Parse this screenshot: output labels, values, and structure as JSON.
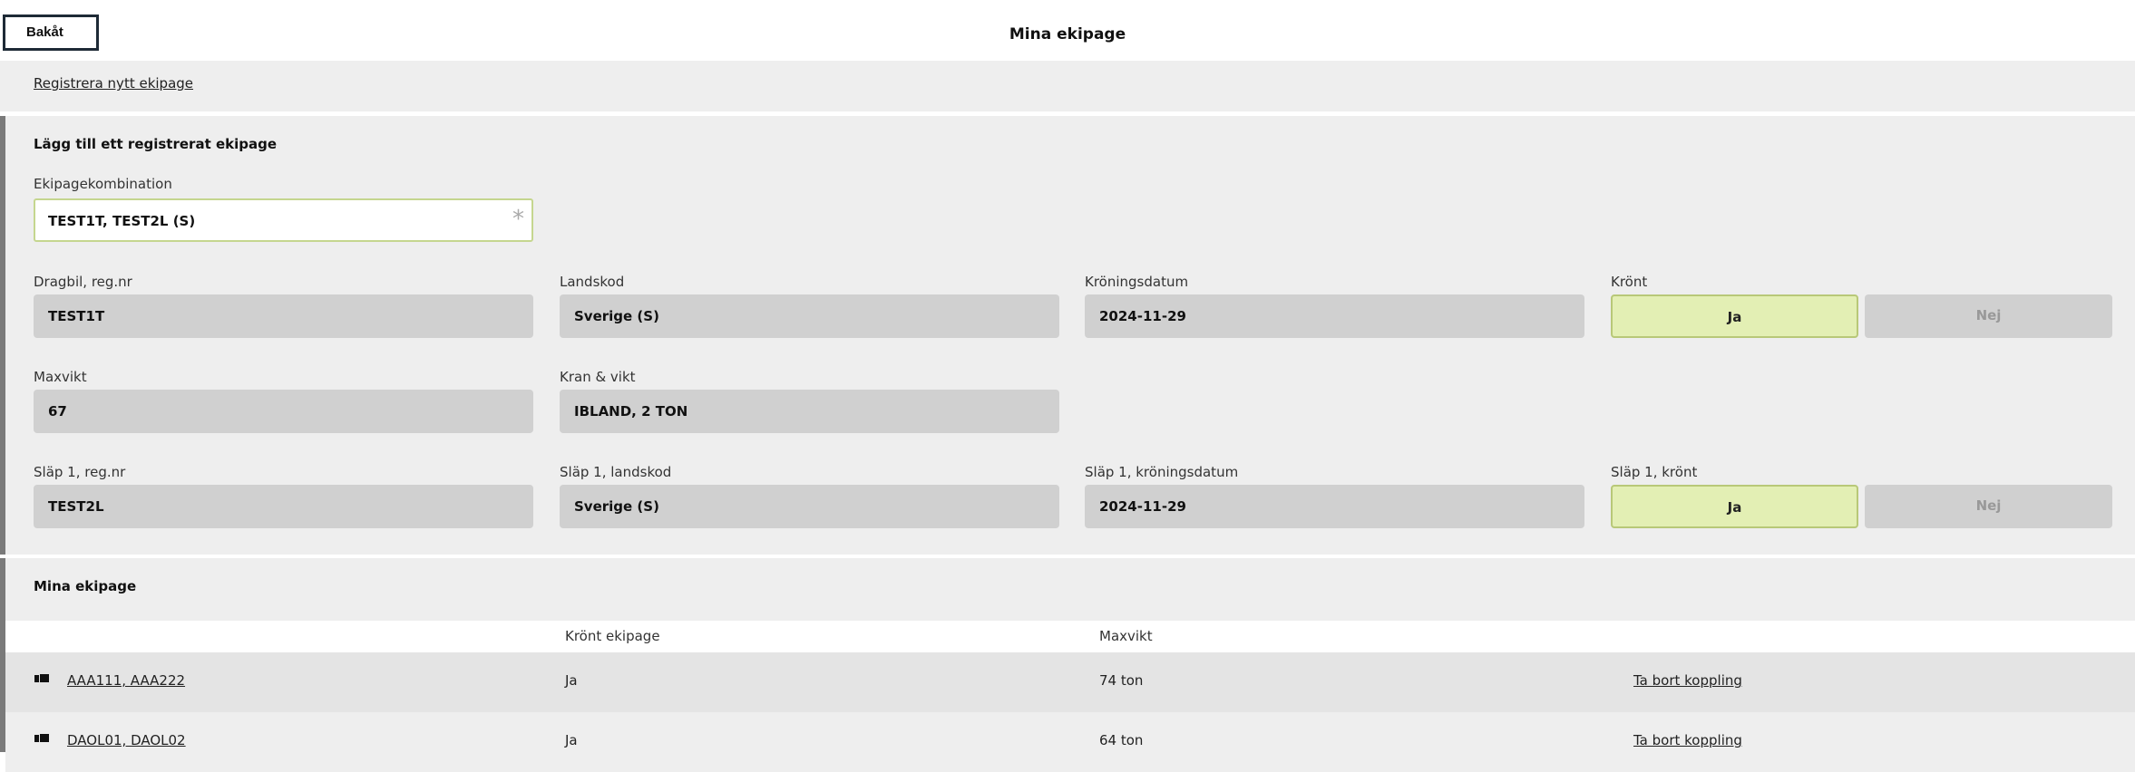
{
  "header": {
    "back_label": "Bakåt",
    "title": "Mina ekipage"
  },
  "register_link": "Registrera nytt ekipage",
  "add_section": {
    "title": "Lägg till ett registrerat ekipage",
    "combination": {
      "label": "Ekipagekombination",
      "value": "TEST1T, TEST2L (S)",
      "required_marker": "*"
    },
    "dragbil_reg": {
      "label": "Dragbil, reg.nr",
      "value": "TEST1T"
    },
    "landskod": {
      "label": "Landskod",
      "value": "Sverige (S)"
    },
    "kroningsdatum": {
      "label": "Kröningsdatum",
      "value": "2024-11-29"
    },
    "kront": {
      "label": "Krönt",
      "yes": "Ja",
      "no": "Nej",
      "selected": "Ja"
    },
    "maxvikt": {
      "label": "Maxvikt",
      "value": "67"
    },
    "kran_vikt": {
      "label": "Kran & vikt",
      "value": "IBLAND, 2 TON"
    },
    "slap1_reg": {
      "label": "Släp 1, reg.nr",
      "value": "TEST2L"
    },
    "slap1_landskod": {
      "label": "Släp 1, landskod",
      "value": "Sverige (S)"
    },
    "slap1_kroningsdatum": {
      "label": "Släp 1, kröningsdatum",
      "value": "2024-11-29"
    },
    "slap1_kront": {
      "label": "Släp 1, krönt",
      "yes": "Ja",
      "no": "Nej",
      "selected": "Ja"
    }
  },
  "mine_section": {
    "title": "Mina ekipage",
    "columns": [
      "Krönt ekipage",
      "Maxvikt"
    ],
    "rows": [
      {
        "name": "AAA111, AAA222",
        "kront": "Ja",
        "maxvikt": "74 ton",
        "action": "Ta bort koppling",
        "icon": "truck-icon"
      },
      {
        "name": "DAOL01, DAOL02",
        "kront": "Ja",
        "maxvikt": "64 ton",
        "action": "Ta bort koppling",
        "icon": "truck-icon"
      }
    ]
  },
  "colors": {
    "accent_selected_bg": "#e3efb4",
    "accent_border": "#b8c878",
    "field_bg": "#d0d0d0",
    "panel_bg": "#eeeeee"
  }
}
